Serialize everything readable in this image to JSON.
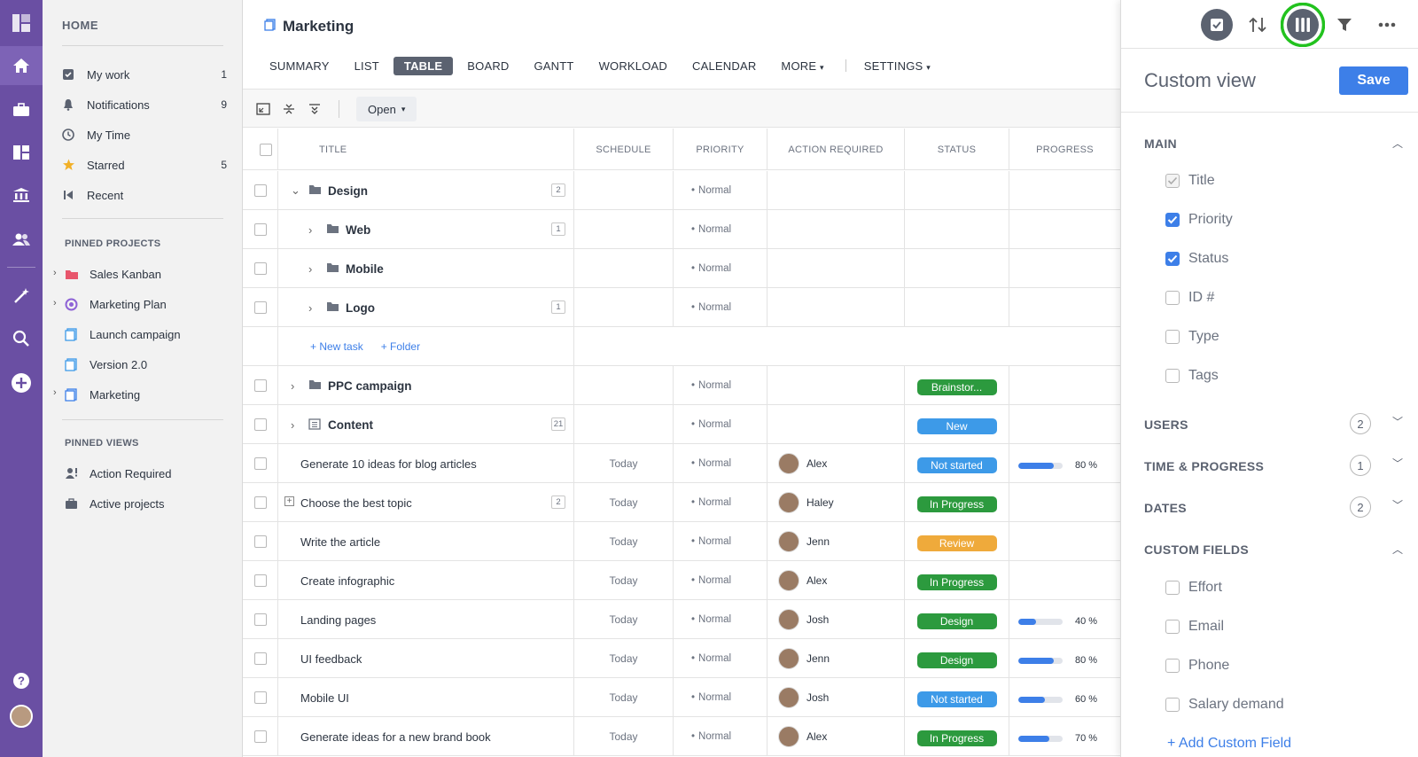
{
  "sidebar": {
    "home_label": "HOME",
    "nav": [
      {
        "label": "My work",
        "count": "1"
      },
      {
        "label": "Notifications",
        "count": "9"
      },
      {
        "label": "My Time",
        "count": ""
      },
      {
        "label": "Starred",
        "count": "5"
      },
      {
        "label": "Recent",
        "count": ""
      }
    ],
    "pinned_projects_label": "PINNED PROJECTS",
    "projects": [
      {
        "label": "Sales Kanban"
      },
      {
        "label": "Marketing Plan"
      },
      {
        "label": "Launch campaign"
      },
      {
        "label": "Version 2.0"
      },
      {
        "label": "Marketing"
      }
    ],
    "pinned_views_label": "PINNED VIEWS",
    "views": [
      {
        "label": "Action Required"
      },
      {
        "label": "Active projects"
      }
    ]
  },
  "header": {
    "title": "Marketing",
    "tabs": [
      "SUMMARY",
      "LIST",
      "TABLE",
      "BOARD",
      "GANTT",
      "WORKLOAD",
      "CALENDAR"
    ],
    "more": "MORE",
    "settings": "SETTINGS"
  },
  "toolbar": {
    "open_label": "Open"
  },
  "table": {
    "headers": {
      "title": "TITLE",
      "schedule": "SCHEDULE",
      "priority": "PRIORITY",
      "action": "ACTION REQUIRED",
      "status": "STATUS",
      "progress": "PROGRESS"
    },
    "rows": [
      {
        "title": "Design",
        "count": "2",
        "schedule": "",
        "priority": "Normal",
        "user": "",
        "status": "",
        "progress": null
      },
      {
        "title": "Web",
        "count": "1",
        "schedule": "",
        "priority": "Normal",
        "user": "",
        "status": "",
        "progress": null
      },
      {
        "title": "Mobile",
        "count": "",
        "schedule": "",
        "priority": "Normal",
        "user": "",
        "status": "",
        "progress": null
      },
      {
        "title": "Logo",
        "count": "1",
        "schedule": "",
        "priority": "Normal",
        "user": "",
        "status": "",
        "progress": null
      },
      {
        "title": "",
        "count": "",
        "schedule": "",
        "priority": "",
        "user": "",
        "status": "",
        "progress": null
      },
      {
        "title": "PPC campaign",
        "count": "",
        "schedule": "",
        "priority": "Normal",
        "user": "",
        "status": "Brainstor...",
        "progress": null
      },
      {
        "title": "Content",
        "count": "21",
        "schedule": "",
        "priority": "Normal",
        "user": "",
        "status": "New",
        "progress": null
      },
      {
        "title": "Generate 10 ideas for blog articles",
        "count": "",
        "schedule": "Today",
        "priority": "Normal",
        "user": "Alex",
        "status": "Not started",
        "progress": 80
      },
      {
        "title": "Choose the best topic",
        "count": "2",
        "schedule": "Today",
        "priority": "Normal",
        "user": "Haley",
        "status": "In Progress",
        "progress": null
      },
      {
        "title": "Write the article",
        "count": "",
        "schedule": "Today",
        "priority": "Normal",
        "user": "Jenn",
        "status": "Review",
        "progress": null
      },
      {
        "title": "Create infographic",
        "count": "",
        "schedule": "Today",
        "priority": "Normal",
        "user": "Alex",
        "status": "In Progress",
        "progress": null
      },
      {
        "title": "Landing pages",
        "count": "",
        "schedule": "Today",
        "priority": "Normal",
        "user": "Josh",
        "status": "Design",
        "progress": 40
      },
      {
        "title": "UI feedback",
        "count": "",
        "schedule": "Today",
        "priority": "Normal",
        "user": "Jenn",
        "status": "Design",
        "progress": 80
      },
      {
        "title": "Mobile UI",
        "count": "",
        "schedule": "Today",
        "priority": "Normal",
        "user": "Josh",
        "status": "Not started",
        "progress": 60
      },
      {
        "title": "Generate ideas for a new brand book",
        "count": "",
        "schedule": "Today",
        "priority": "Normal",
        "user": "Alex",
        "status": "In Progress",
        "progress": 70
      }
    ],
    "new_task": "+ New task",
    "new_folder": "+ Folder",
    "pct_suffix": " %"
  },
  "status_colors": {
    "Brainstor...": "#2c9a3e",
    "New": "#3d9ae8",
    "Not started": "#3d9ae8",
    "In Progress": "#2c9a3e",
    "Review": "#efaa3b",
    "Design": "#2c9a3e"
  },
  "panel": {
    "title": "Custom view",
    "save": "Save",
    "main_label": "MAIN",
    "main_options": [
      {
        "label": "Title",
        "state": "disabled"
      },
      {
        "label": "Priority",
        "state": "on"
      },
      {
        "label": "Status",
        "state": "on"
      },
      {
        "label": "ID #",
        "state": "off"
      },
      {
        "label": "Type",
        "state": "off"
      },
      {
        "label": "Tags",
        "state": "off"
      }
    ],
    "users_label": "USERS",
    "users_count": "2",
    "time_label": "TIME & PROGRESS",
    "time_count": "1",
    "dates_label": "DATES",
    "dates_count": "2",
    "custom_label": "CUSTOM FIELDS",
    "custom_options": [
      {
        "label": "Effort",
        "state": "off"
      },
      {
        "label": "Email",
        "state": "off"
      },
      {
        "label": "Phone",
        "state": "off"
      },
      {
        "label": "Salary demand",
        "state": "off"
      }
    ],
    "add_custom": "+ Add Custom Field"
  },
  "colors": {
    "rail": "#6a4fa3",
    "accent": "#3d7fe8",
    "highlight_ring": "#22c21e"
  }
}
